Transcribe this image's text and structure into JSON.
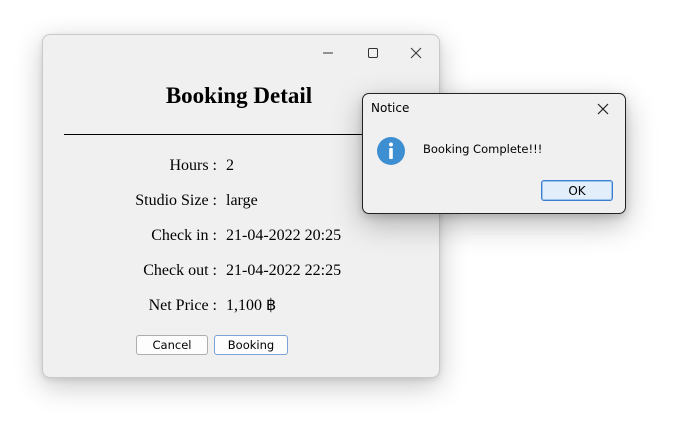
{
  "main_window": {
    "title": "Booking Detail",
    "fields": [
      {
        "label": "Hours :",
        "value": "2"
      },
      {
        "label": "Studio Size :",
        "value": "large"
      },
      {
        "label": "Check in :",
        "value": "21-04-2022 20:25"
      },
      {
        "label": "Check out :",
        "value": "21-04-2022 22:25"
      },
      {
        "label": "Net Price :",
        "value": "1,100 ฿"
      }
    ],
    "buttons": {
      "cancel": "Cancel",
      "booking": "Booking"
    },
    "caption_icons": [
      "minimize-icon",
      "maximize-icon",
      "close-icon"
    ]
  },
  "notice_dialog": {
    "title": "Notice",
    "message": "Booking Complete!!!",
    "ok_label": "OK",
    "icon": "info-icon",
    "icon_color": "#3d8fd1"
  }
}
